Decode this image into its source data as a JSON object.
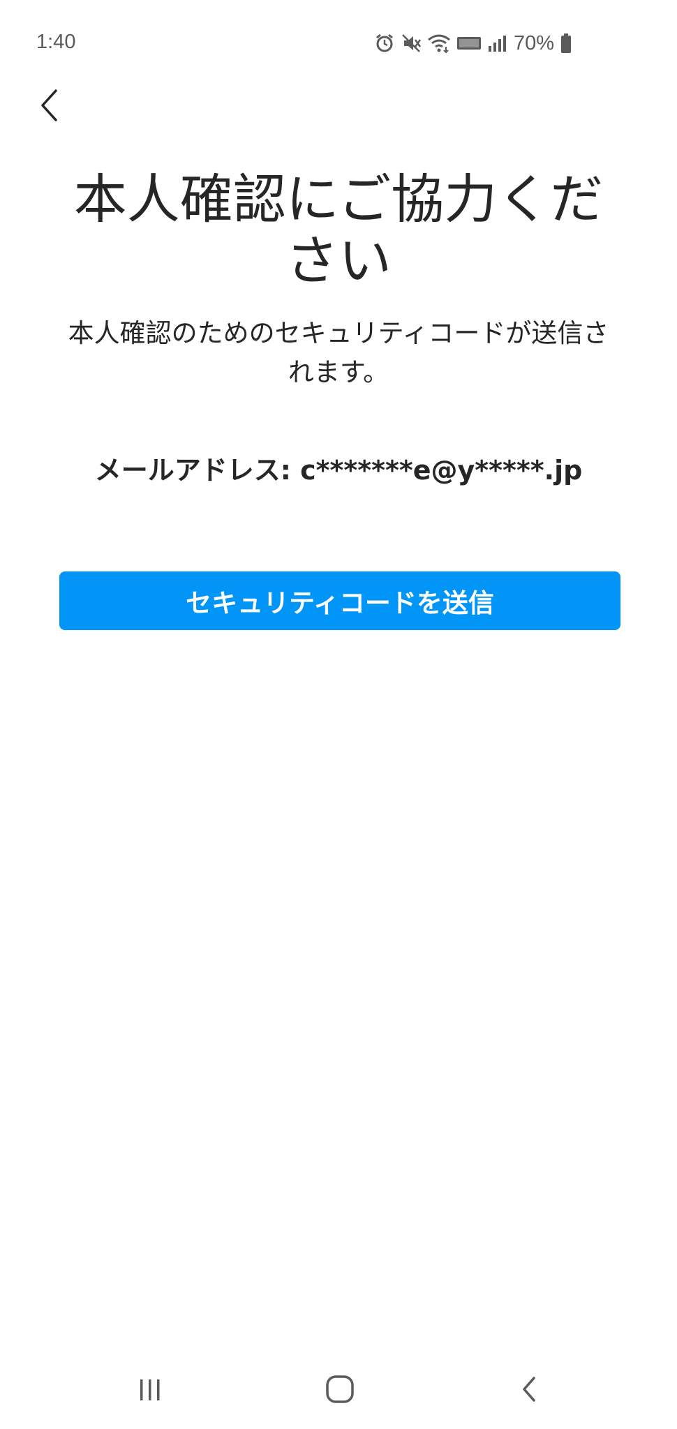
{
  "status_bar": {
    "time": "1:40",
    "battery_percent": "70%",
    "icons": [
      "alarm-icon",
      "mute-icon",
      "wifi-icon",
      "volte-icon",
      "signal-icon",
      "battery-icon"
    ]
  },
  "header": {
    "back_icon": "chevron-left-icon"
  },
  "main": {
    "title": "本人確認にご協力ください",
    "description": "本人確認のためのセキュリティコードが送信されます。",
    "email_label": "メールアドレス: c*******e@y*****.jp",
    "send_button_label": "セキュリティコードを送信"
  },
  "colors": {
    "accent": "#0095f6",
    "text": "#262626",
    "status_text": "#5a5a5a"
  },
  "nav_bar": {
    "icons": [
      "recent-apps-icon",
      "home-icon",
      "back-icon"
    ]
  }
}
